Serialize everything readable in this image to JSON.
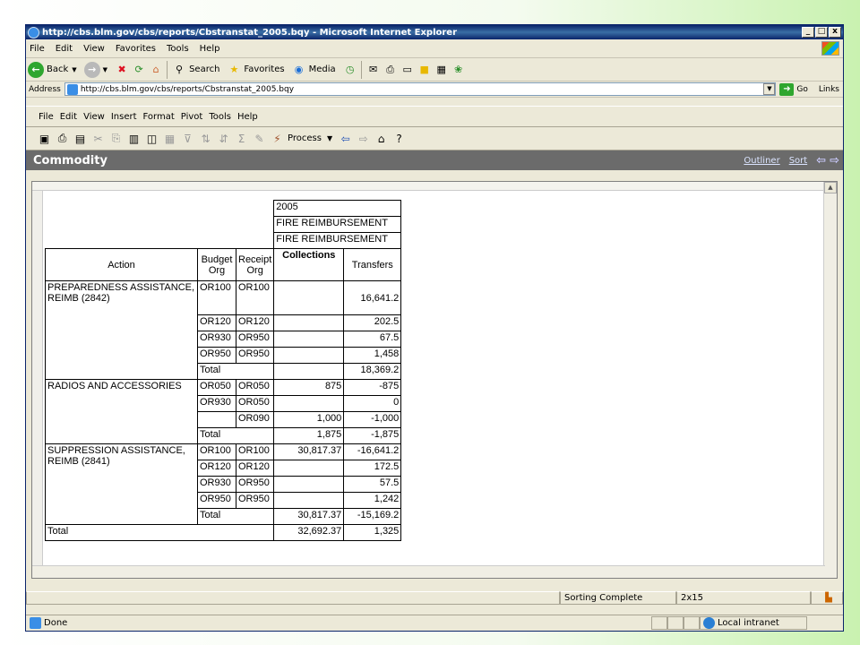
{
  "browser": {
    "title": "http://cbs.blm.gov/cbs/reports/Cbstranstat_2005.bqy - Microsoft Internet Explorer",
    "menu": [
      "File",
      "Edit",
      "View",
      "Favorites",
      "Tools",
      "Help"
    ],
    "toolbar": {
      "back": "Back",
      "search": "Search",
      "favorites": "Favorites",
      "media": "Media"
    },
    "address_label": "Address",
    "address_value": "http://cbs.blm.gov/cbs/reports/Cbstranstat_2005.bqy",
    "go": "Go",
    "links": "Links",
    "status": "Done",
    "zone": "Local intranet"
  },
  "app": {
    "menu": [
      "File",
      "Edit",
      "View",
      "Insert",
      "Format",
      "Pivot",
      "Tools",
      "Help"
    ],
    "process_label": "Process",
    "section_title": "Commodity",
    "outliner": "Outliner",
    "sort": "Sort",
    "status_text": "Sorting Complete",
    "status_dims": "2x15"
  },
  "report": {
    "year": "2005",
    "filter1": "FIRE REIMBURSEMENT",
    "filter2": "FIRE REIMBURSEMENT",
    "headers": {
      "action": "Action",
      "budget_org": "Budget Org",
      "receipt_org": "Receipt Org",
      "collections": "Collections",
      "transfers": "Transfers"
    },
    "groups": [
      {
        "action": "PREPAREDNESS ASSISTANCE, REIMB (2842)",
        "rows": [
          {
            "budget": "OR100",
            "receipt": "OR100",
            "collections": "",
            "transfers": "16,641.2"
          },
          {
            "budget": "OR120",
            "receipt": "OR120",
            "collections": "",
            "transfers": "202.5"
          },
          {
            "budget": "OR930",
            "receipt": "OR950",
            "collections": "",
            "transfers": "67.5"
          },
          {
            "budget": "OR950",
            "receipt": "OR950",
            "collections": "",
            "transfers": "1,458"
          }
        ],
        "total_label": "Total",
        "total_collections": "",
        "total_transfers": "18,369.2"
      },
      {
        "action": "RADIOS AND ACCESSORIES",
        "rows": [
          {
            "budget": "OR050",
            "receipt": "OR050",
            "collections": "875",
            "transfers": "-875"
          },
          {
            "budget": "OR930",
            "receipt": "OR050",
            "collections": "",
            "transfers": "0"
          },
          {
            "budget": "",
            "receipt": "OR090",
            "collections": "1,000",
            "transfers": "-1,000"
          }
        ],
        "total_label": "Total",
        "total_collections": "1,875",
        "total_transfers": "-1,875"
      },
      {
        "action": "SUPPRESSION ASSISTANCE, REIMB (2841)",
        "rows": [
          {
            "budget": "OR100",
            "receipt": "OR100",
            "collections": "30,817.37",
            "transfers": "-16,641.2"
          },
          {
            "budget": "OR120",
            "receipt": "OR120",
            "collections": "",
            "transfers": "172.5"
          },
          {
            "budget": "OR930",
            "receipt": "OR950",
            "collections": "",
            "transfers": "57.5"
          },
          {
            "budget": "OR950",
            "receipt": "OR950",
            "collections": "",
            "transfers": "1,242"
          }
        ],
        "total_label": "Total",
        "total_collections": "30,817.37",
        "total_transfers": "-15,169.2"
      }
    ],
    "grand_total_label": "Total",
    "grand_total_collections": "32,692.37",
    "grand_total_transfers": "1,325"
  }
}
